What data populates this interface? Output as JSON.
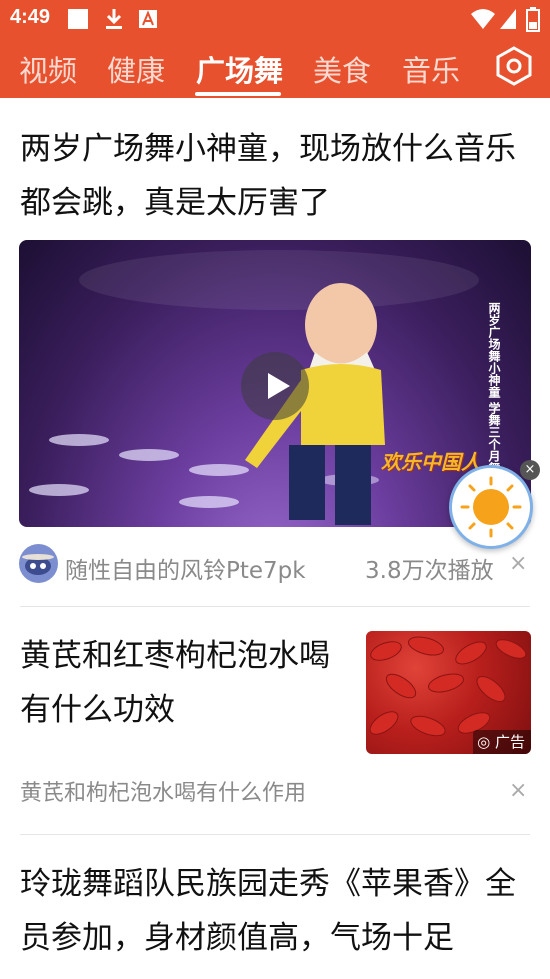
{
  "status_bar": {
    "time": "4:49",
    "icons": [
      "app-square-icon",
      "download-icon",
      "notification-a-icon",
      "wifi-icon",
      "signal-icon",
      "battery-icon"
    ]
  },
  "tabs": [
    {
      "label": "视频",
      "active": false
    },
    {
      "label": "健康",
      "active": false
    },
    {
      "label": "广场舞",
      "active": true
    },
    {
      "label": "美食",
      "active": false
    },
    {
      "label": "音乐",
      "active": false
    }
  ],
  "feed": {
    "video_item": {
      "title": "两岁广场舞小神童，现场放什么音乐都会跳，真是太厉害了",
      "overlay_caption": "两岁广场舞小神童 学舞三个月舞技惊人",
      "show_logo": "欢乐中国人",
      "author": "随性自由的风铃Pte7pk",
      "play_count": "3.8万次播放"
    },
    "ad_item": {
      "title": "黄芪和红枣枸杞泡水喝有什么功效",
      "ad_badge": "广告",
      "subtitle": "黄芪和枸杞泡水喝有什么作用"
    },
    "text_item": {
      "title": "玲珑舞蹈队民族园走秀《苹果香》全员参加，身材颜值高，气场十足"
    }
  },
  "colors": {
    "brand": "#e8512e",
    "meta_text": "#8a8a8a"
  }
}
